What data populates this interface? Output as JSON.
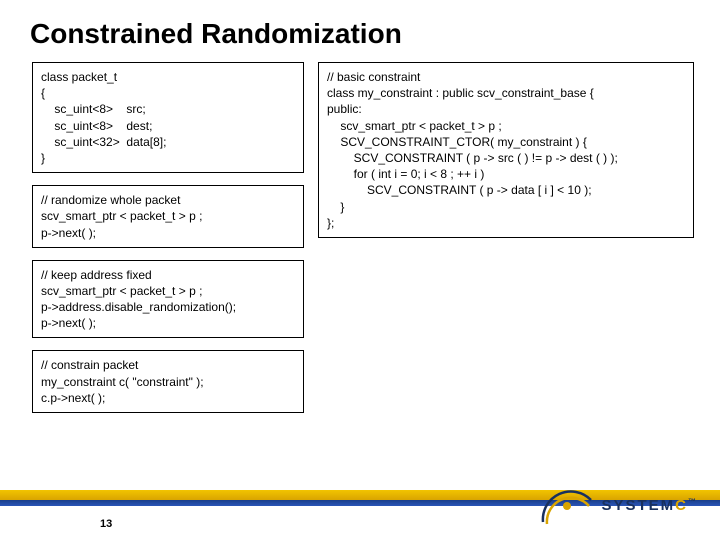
{
  "title": "Constrained Randomization",
  "page_number": "13",
  "logo_text": "SYSTEM",
  "logo_c": "C",
  "logo_tm": "™",
  "code_boxes": {
    "box1": "class packet_t\n{\n    sc_uint<8>    src;\n    sc_uint<8>    dest;\n    sc_uint<32>  data[8];\n}",
    "box2": "// randomize whole packet\nscv_smart_ptr < packet_t > p ;\np->next( );",
    "box3": "// keep address fixed\nscv_smart_ptr < packet_t > p ;\np->address.disable_randomization();\np->next( );",
    "box4": "// constrain packet\nmy_constraint c( \"constraint\" );\nc.p->next( );",
    "box5": "// basic constraint\nclass my_constraint : public scv_constraint_base {\npublic:\n    scv_smart_ptr < packet_t > p ;\n    SCV_CONSTRAINT_CTOR( my_constraint ) {\n        SCV_CONSTRAINT ( p -> src ( ) != p -> dest ( ) );\n        for ( int i = 0; i < 8 ; ++ i )\n            SCV_CONSTRAINT ( p -> data [ i ] < 10 );\n    }\n};"
  }
}
